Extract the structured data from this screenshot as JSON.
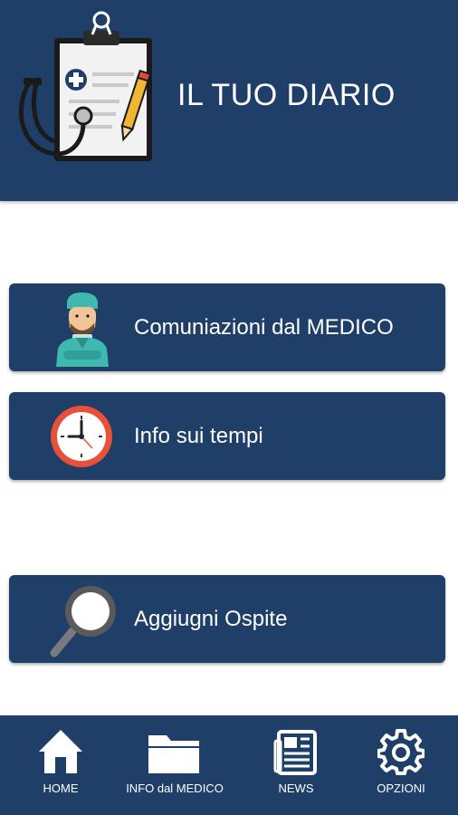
{
  "header": {
    "title": "IL TUO DIARIO",
    "logo_icon": "clipboard-stethoscope-icon"
  },
  "menu": [
    {
      "label": "Comuniazioni dal MEDICO",
      "icon": "doctor-icon"
    },
    {
      "label": "Info sui tempi",
      "icon": "clock-icon"
    },
    {
      "label": "Aggiugni Ospite",
      "icon": "magnifier-icon"
    }
  ],
  "bottom_nav": [
    {
      "label": "HOME",
      "icon": "home-icon"
    },
    {
      "label": "INFO dal MEDICO",
      "icon": "folder-icon"
    },
    {
      "label": "NEWS",
      "icon": "newspaper-icon"
    },
    {
      "label": "OPZIONI",
      "icon": "gear-icon"
    }
  ],
  "colors": {
    "primary": "#1f3f68",
    "background": "#ffffff",
    "text": "#ffffff"
  }
}
